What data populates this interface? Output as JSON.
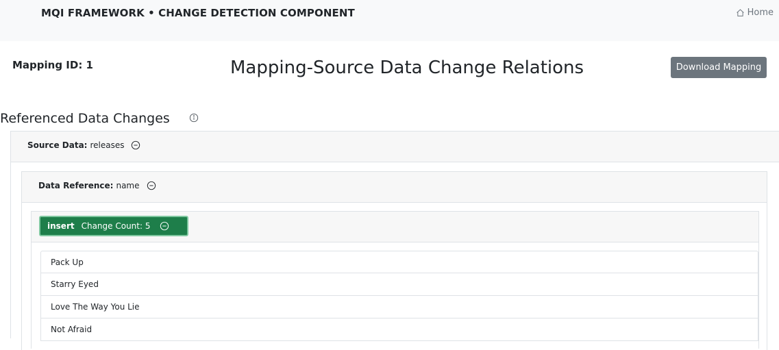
{
  "header": {
    "brand": "MQI FRAMEWORK • CHANGE DETECTION COMPONENT",
    "home_label": "Home"
  },
  "mapping": {
    "id_label": "Mapping ID: 1",
    "title": "Mapping-Source Data Change Relations",
    "download_label": "Download Mapping"
  },
  "section": {
    "heading": "Referenced Data Changes"
  },
  "source": {
    "key": "Source Data:",
    "value": "releases"
  },
  "reference": {
    "key": "Data Reference:",
    "value": "name"
  },
  "change": {
    "operation": "insert",
    "count_label": "Change Count: 5"
  },
  "items": [
    "Pack Up",
    "Starry Eyed",
    "Love The Way You Lie",
    "Not Afraid"
  ],
  "colors": {
    "accent_green": "#1e7e4a",
    "button_gray": "#6c757d"
  }
}
